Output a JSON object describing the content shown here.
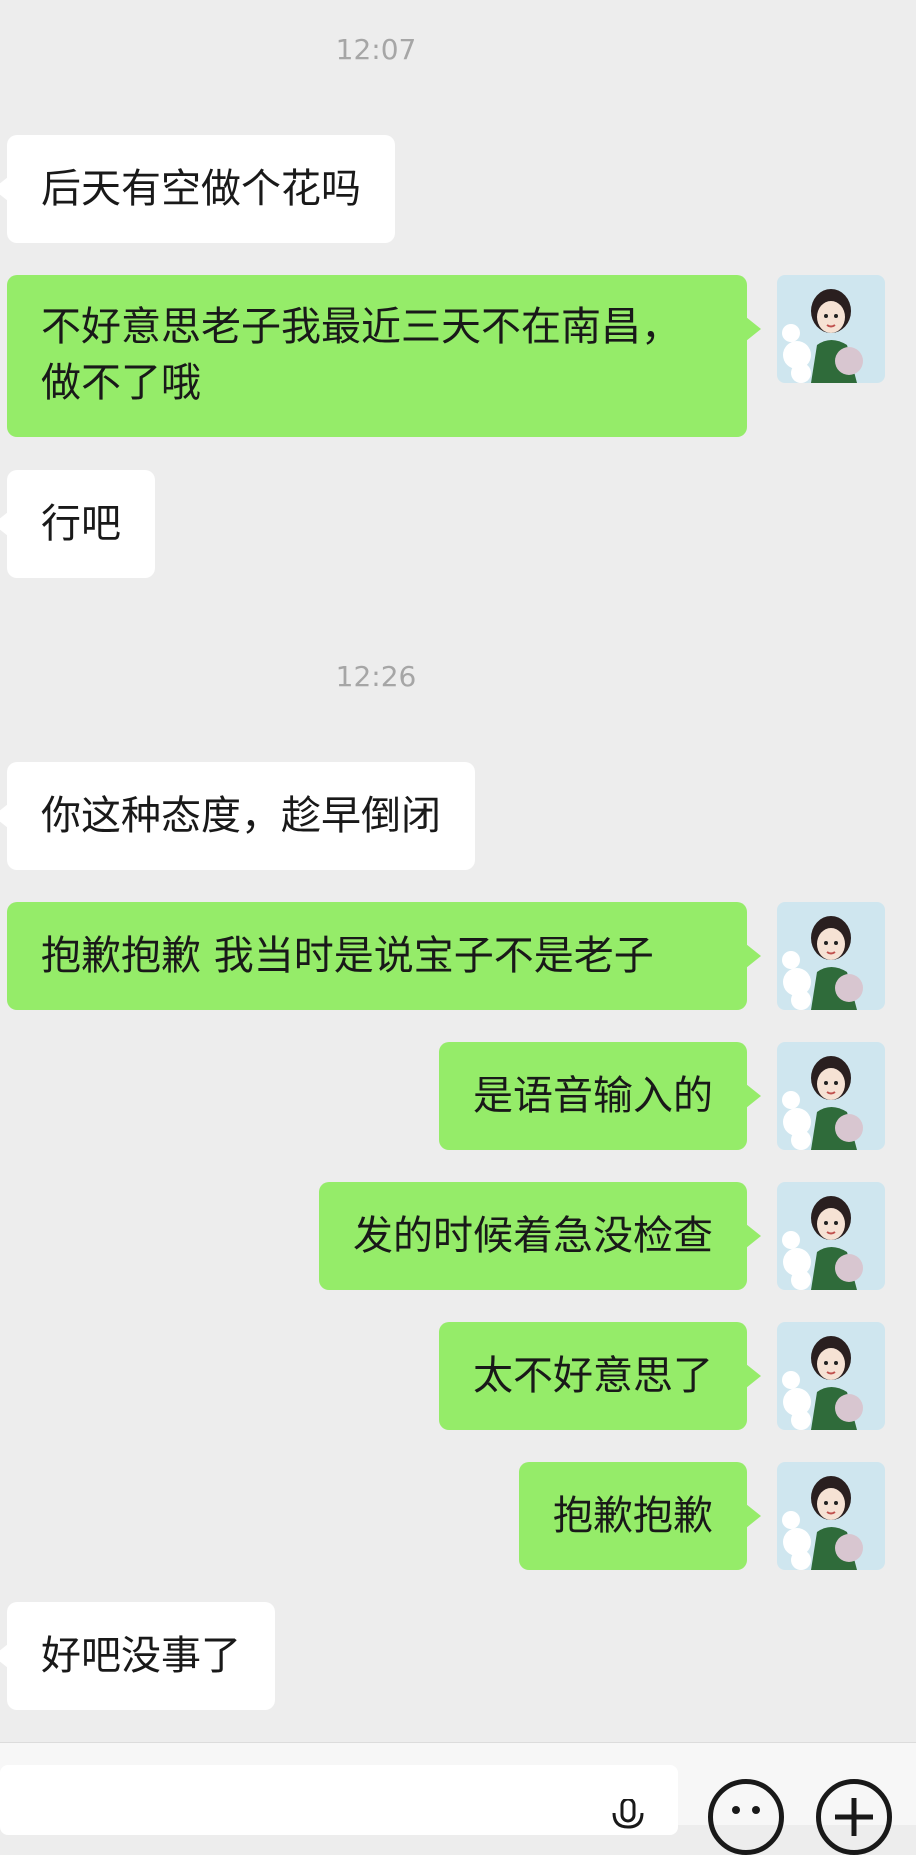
{
  "colors": {
    "background": "#ededed",
    "incoming_bubble": "#ffffff",
    "outgoing_bubble": "#95ec69",
    "timestamp_text": "#a6a6a6",
    "message_text": "#191919"
  },
  "messages": [
    {
      "type": "time",
      "text": "12:07"
    },
    {
      "type": "in",
      "text": "后天有空做个花吗"
    },
    {
      "type": "out",
      "text": "不好意思老子我最近三天不在南昌，做不了哦"
    },
    {
      "type": "in",
      "text": "行吧"
    },
    {
      "type": "time",
      "text": "12:26"
    },
    {
      "type": "in",
      "text": "你这种态度，趁早倒闭"
    },
    {
      "type": "out",
      "text": "抱歉抱歉 我当时是说宝子不是老子"
    },
    {
      "type": "out",
      "text": "是语音输入的"
    },
    {
      "type": "out",
      "text": "发的时候着急没检查"
    },
    {
      "type": "out",
      "text": "太不好意思了"
    },
    {
      "type": "out",
      "text": "抱歉抱歉"
    },
    {
      "type": "in",
      "text": "好吧没事了"
    }
  ],
  "input_bar": {
    "voice_icon": "microphone-icon",
    "emoji_icon": "emoji-icon",
    "more_icon": "plus-icon"
  }
}
